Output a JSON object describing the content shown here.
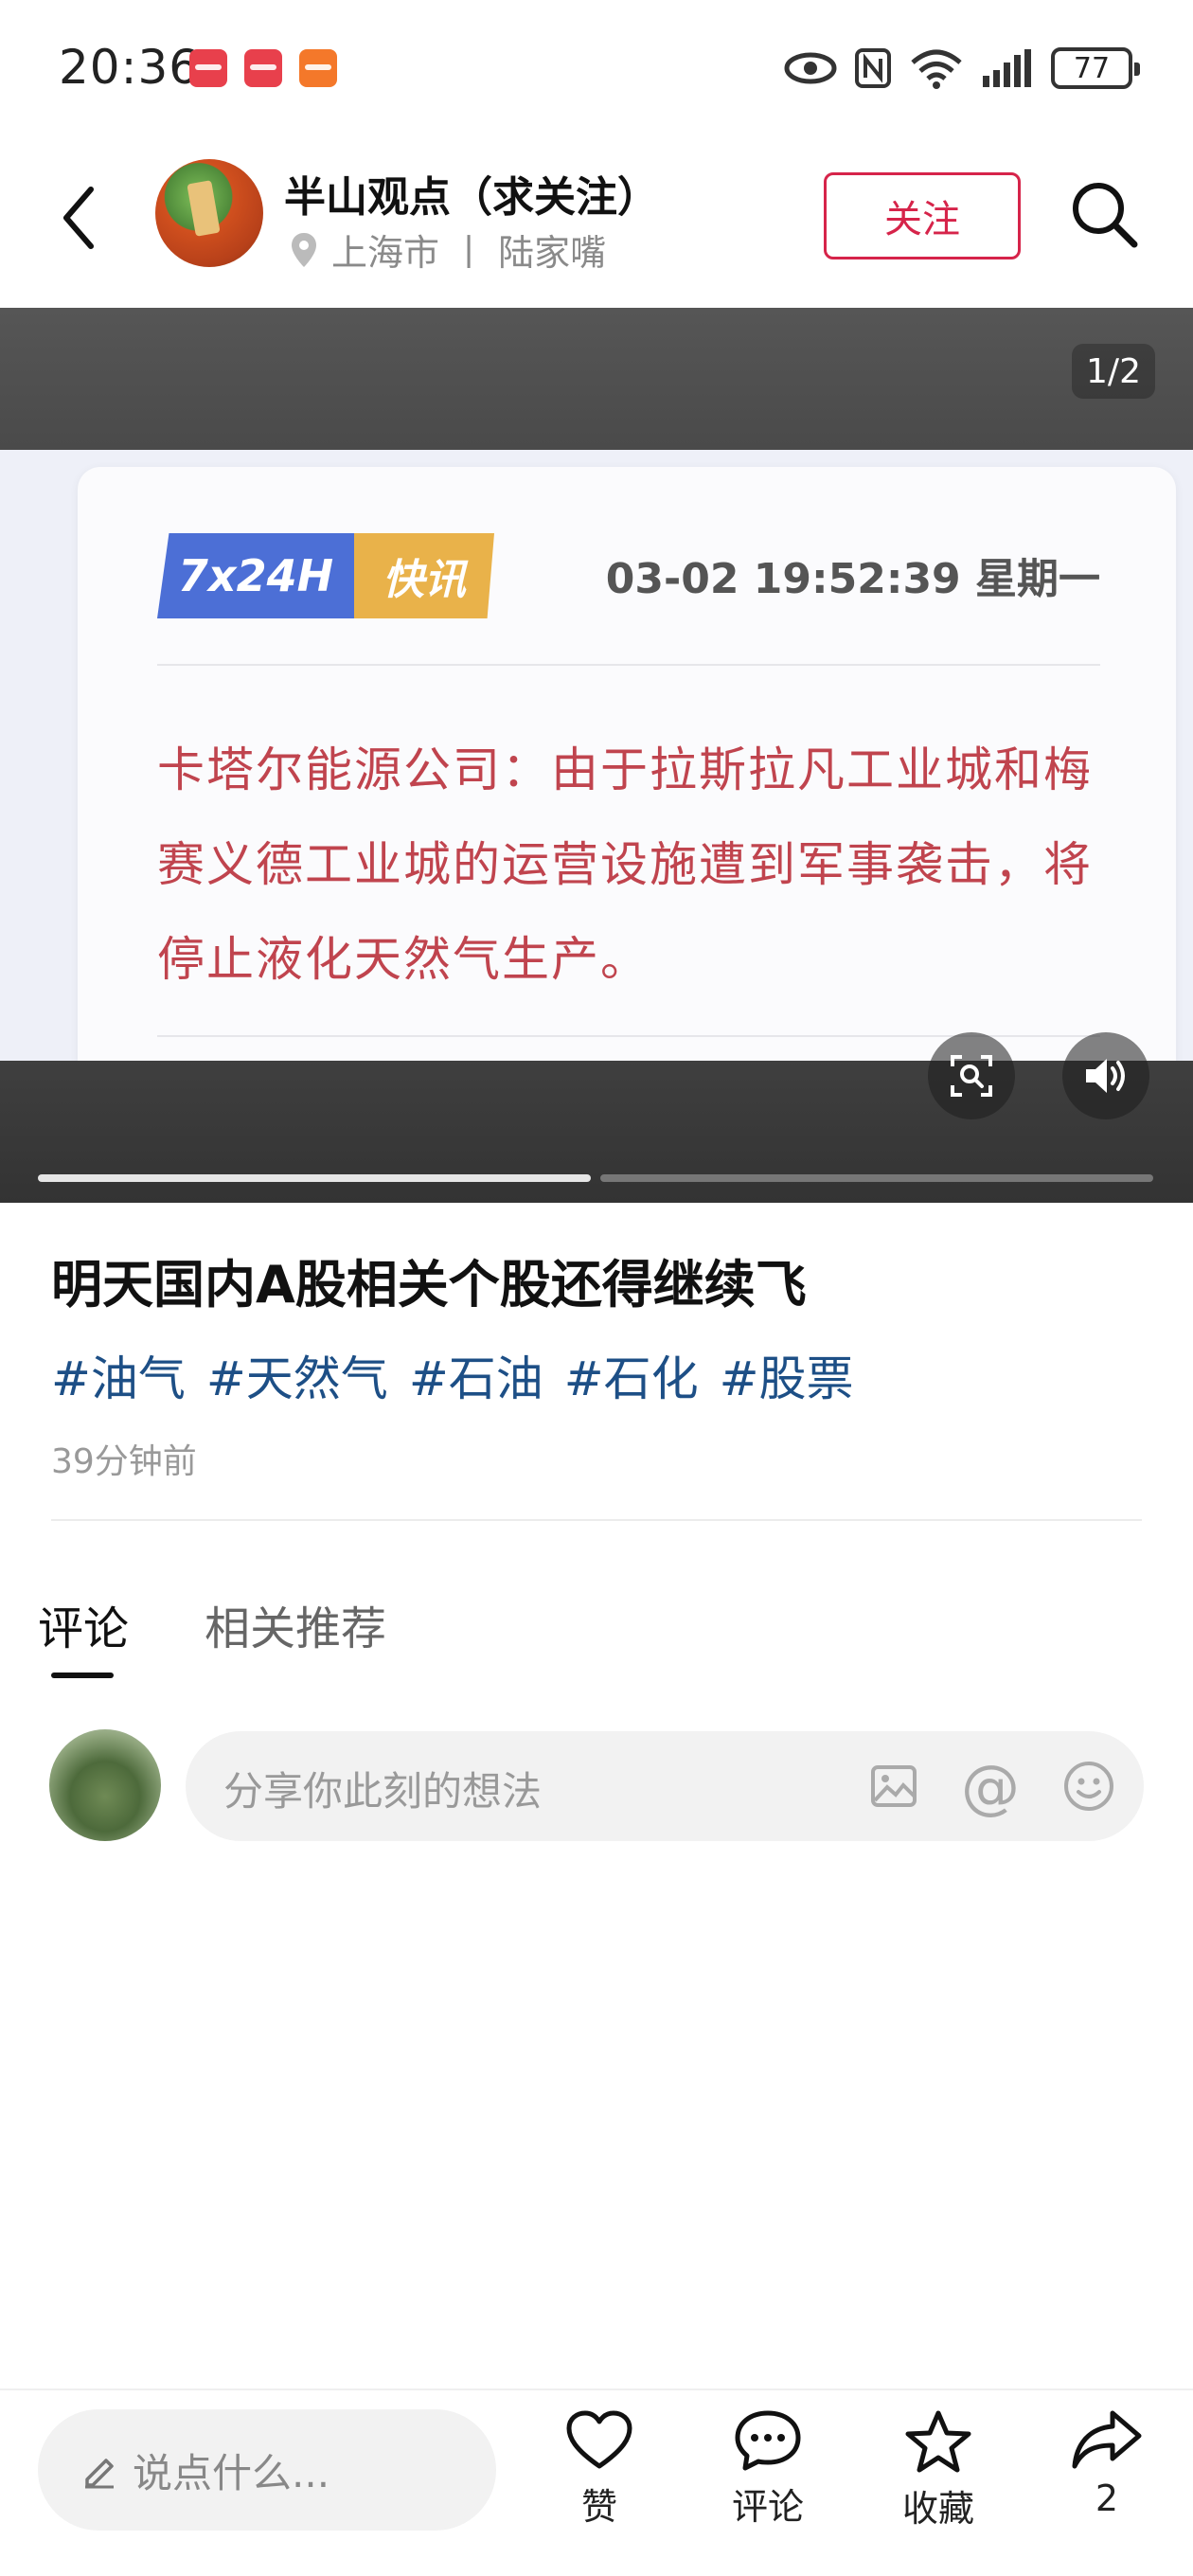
{
  "status_bar": {
    "time": "20:36",
    "battery": "77"
  },
  "header": {
    "author_name": "半山观点（求关注）",
    "location": "上海市 丨 陆家嘴",
    "follow_label": "关注"
  },
  "media": {
    "counter": "1/2",
    "badge_left": "7x24H",
    "badge_right": "快讯",
    "news_time": "03-02 19:52:39 星期一",
    "news_body": "卡塔尔能源公司：由于拉斯拉凡工业城和梅赛义德工业城的运营设施遭到军事袭击，将停止液化天然气生产。",
    "slide_progress": 0.5
  },
  "post": {
    "title": "明天国内A股相关个股还得继续飞",
    "tags": [
      "#油气",
      "#天然气",
      "#石油",
      "#石化",
      "#股票"
    ],
    "time": "39分钟前"
  },
  "tabs": {
    "comments": "评论",
    "related": "相关推荐"
  },
  "comment_input": {
    "placeholder": "分享你此刻的想法"
  },
  "bottom_bar": {
    "say_placeholder": "说点什么...",
    "like_label": "赞",
    "comment_label": "评论",
    "favorite_label": "收藏",
    "share_count": "2"
  },
  "colors": {
    "accent_red": "#d6244a",
    "tag_blue": "#1d4f86",
    "news_red": "#c0444e"
  },
  "icons": [
    "back-arrow-icon",
    "location-pin-icon",
    "search-icon",
    "zoom-scan-icon",
    "speaker-icon",
    "image-icon",
    "at-icon",
    "emoji-icon",
    "pencil-icon",
    "heart-icon",
    "comment-icon",
    "star-icon",
    "share-icon"
  ]
}
